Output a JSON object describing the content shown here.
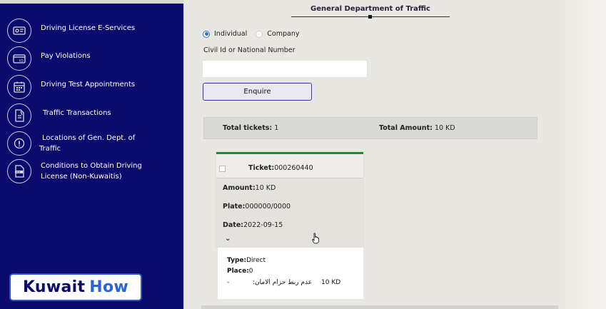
{
  "sidebar": {
    "items": [
      {
        "label": "Driving License E-Services",
        "icon": "license-card-icon"
      },
      {
        "label": "Pay Violations",
        "icon": "payment-card-icon"
      },
      {
        "label": "Driving Test Appointments",
        "icon": "calendar-icon"
      },
      {
        "label": "Traffic Transactions",
        "icon": "document-icon"
      },
      {
        "label_line1": "Locations of Gen. Dept. of",
        "label_line2": "Traffic",
        "icon": "location-icon"
      },
      {
        "label_line1": "Conditions to Obtain Driving",
        "label_line2": "License (Non-Kuwaitis)",
        "icon": "pdf-file-icon"
      }
    ]
  },
  "brand": {
    "word1": "Kuwait",
    "word2": "How"
  },
  "header": {
    "title": "General Department of Traffic"
  },
  "form": {
    "radio_individual": "Individual",
    "radio_company": "Company",
    "civil_id_label": "Civil Id or National Number",
    "civil_id_value": "",
    "enquire_label": "Enquire"
  },
  "summary": {
    "total_tickets_label": "Total tickets:",
    "total_tickets_value": "1",
    "total_amount_label": "Total Amount:",
    "total_amount_value": "10 KD"
  },
  "ticket": {
    "title_label": "Ticket:",
    "title_value": "000260440",
    "amount_label": "Amount:",
    "amount_value": "10 KD",
    "plate_label": "Plate:",
    "plate_value": "000000/0000",
    "date_label": "Date:",
    "date_value": "2022-09-15",
    "expand_glyph": "⌄"
  },
  "details": {
    "type_label": "Type:",
    "type_value": "Direct",
    "place_label": "Place:",
    "place_value": "0",
    "violation_prefix": "-",
    "violation_text": "عدم ربط حزام الامان:",
    "violation_amount": "10 KD"
  },
  "colors": {
    "sidebar_bg": "#0b0b6e",
    "accent_blue": "#2f6fd6",
    "ticket_green": "#1f8a2f"
  }
}
